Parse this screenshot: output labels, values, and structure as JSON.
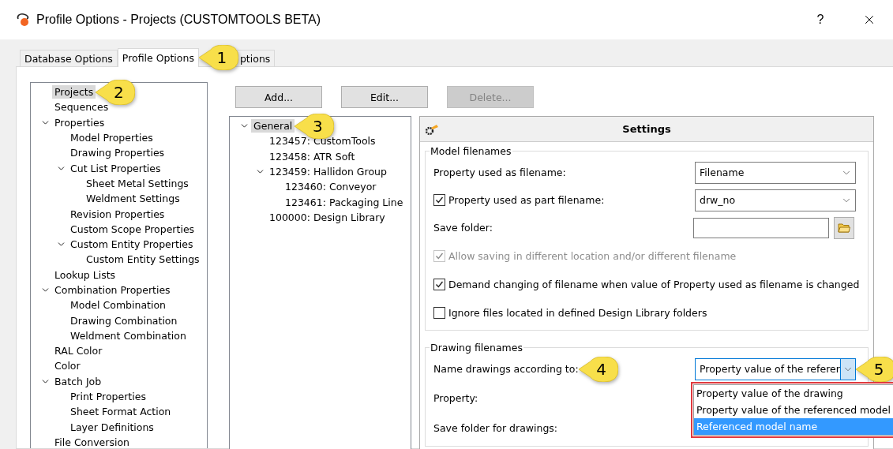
{
  "window": {
    "title": "Profile Options - Projects (CUSTOMTOOLS BETA)",
    "help": "?"
  },
  "tabs": [
    {
      "label": "Database Options",
      "selected": false
    },
    {
      "label": "Profile Options",
      "selected": true,
      "callout": "1"
    },
    {
      "label": "ptions",
      "selected": false
    }
  ],
  "nav_tree": [
    {
      "label": "Projects",
      "selected": true,
      "callout": "2"
    },
    {
      "label": "Sequences",
      "selected": false
    },
    {
      "label": "Properties",
      "selected": false,
      "children": [
        {
          "label": "Model Properties",
          "selected": false
        },
        {
          "label": "Drawing Properties",
          "selected": false
        },
        {
          "label": "Cut List Properties",
          "selected": false,
          "children": [
            {
              "label": "Sheet Metal Settings",
              "selected": false
            },
            {
              "label": "Weldment Settings",
              "selected": false
            }
          ]
        },
        {
          "label": "Revision Properties",
          "selected": false
        },
        {
          "label": "Custom Scope Properties",
          "selected": false
        },
        {
          "label": "Custom Entity Properties",
          "selected": false,
          "children": [
            {
              "label": "Custom Entity Settings",
              "selected": false
            }
          ]
        }
      ]
    },
    {
      "label": "Lookup Lists",
      "selected": false
    },
    {
      "label": "Combination Properties",
      "selected": false,
      "children": [
        {
          "label": "Model Combination",
          "selected": false
        },
        {
          "label": "Drawing Combination",
          "selected": false
        },
        {
          "label": "Weldment Combination",
          "selected": false
        }
      ]
    },
    {
      "label": "RAL Color",
      "selected": false
    },
    {
      "label": "Color",
      "selected": false
    },
    {
      "label": "Batch Job",
      "selected": false,
      "children": [
        {
          "label": "Print Properties",
          "selected": false
        },
        {
          "label": "Sheet Format Action",
          "selected": false
        },
        {
          "label": "Layer Definitions",
          "selected": false
        }
      ]
    },
    {
      "label": "File Conversion",
      "selected": false
    }
  ],
  "buttons": [
    {
      "label": "Add...",
      "disabled": false
    },
    {
      "label": "Edit...",
      "disabled": false
    },
    {
      "label": "Delete...",
      "disabled": true
    }
  ],
  "project_tree": [
    {
      "label": "General",
      "selected": true,
      "callout": "3",
      "children": [
        {
          "label": "123457: CustomTools",
          "selected": false
        },
        {
          "label": "123458: ATR Soft",
          "selected": false
        },
        {
          "label": "123459: Hallidon Group",
          "selected": false,
          "children": [
            {
              "label": "123460: Conveyor",
              "selected": false
            },
            {
              "label": "123461: Packaging Line",
              "selected": false
            }
          ]
        },
        {
          "label": "100000: Design Library",
          "selected": false
        }
      ]
    }
  ],
  "settings": {
    "title": "Settings",
    "model_filenames": {
      "title": "Model filenames",
      "rows": [
        {
          "kind": "select",
          "label": "Property used as filename:",
          "value": "Filename"
        },
        {
          "kind": "select",
          "label": "Property used as part filename:",
          "value": "drw_no",
          "checked": true
        },
        {
          "kind": "folder",
          "label": "Save folder:"
        },
        {
          "kind": "check",
          "label": "Allow saving in different location and/or different filename",
          "checked": true,
          "disabled": true
        },
        {
          "kind": "check",
          "label": "Demand changing of filename when value of Property used as filename is changed",
          "checked": true,
          "disabled": false
        },
        {
          "kind": "check",
          "label": "Ignore files located in defined Design Library folders",
          "checked": false,
          "disabled": false
        }
      ]
    },
    "drawing_filenames": {
      "title": "Drawing filenames",
      "rows": [
        {
          "kind": "select",
          "label": "Name drawings according to:",
          "value": "Property value of the referer",
          "label_callout": "4",
          "button_callout": "5",
          "open": true,
          "options": [
            {
              "label": "Property value of the drawing",
              "selected": false
            },
            {
              "label": "Property value of the referenced model",
              "selected": false
            },
            {
              "label": "Referenced model name",
              "selected": true
            }
          ]
        },
        {
          "kind": "plain",
          "label": "Property:"
        },
        {
          "kind": "plain",
          "label": "Save folder for drawings:"
        }
      ]
    }
  }
}
